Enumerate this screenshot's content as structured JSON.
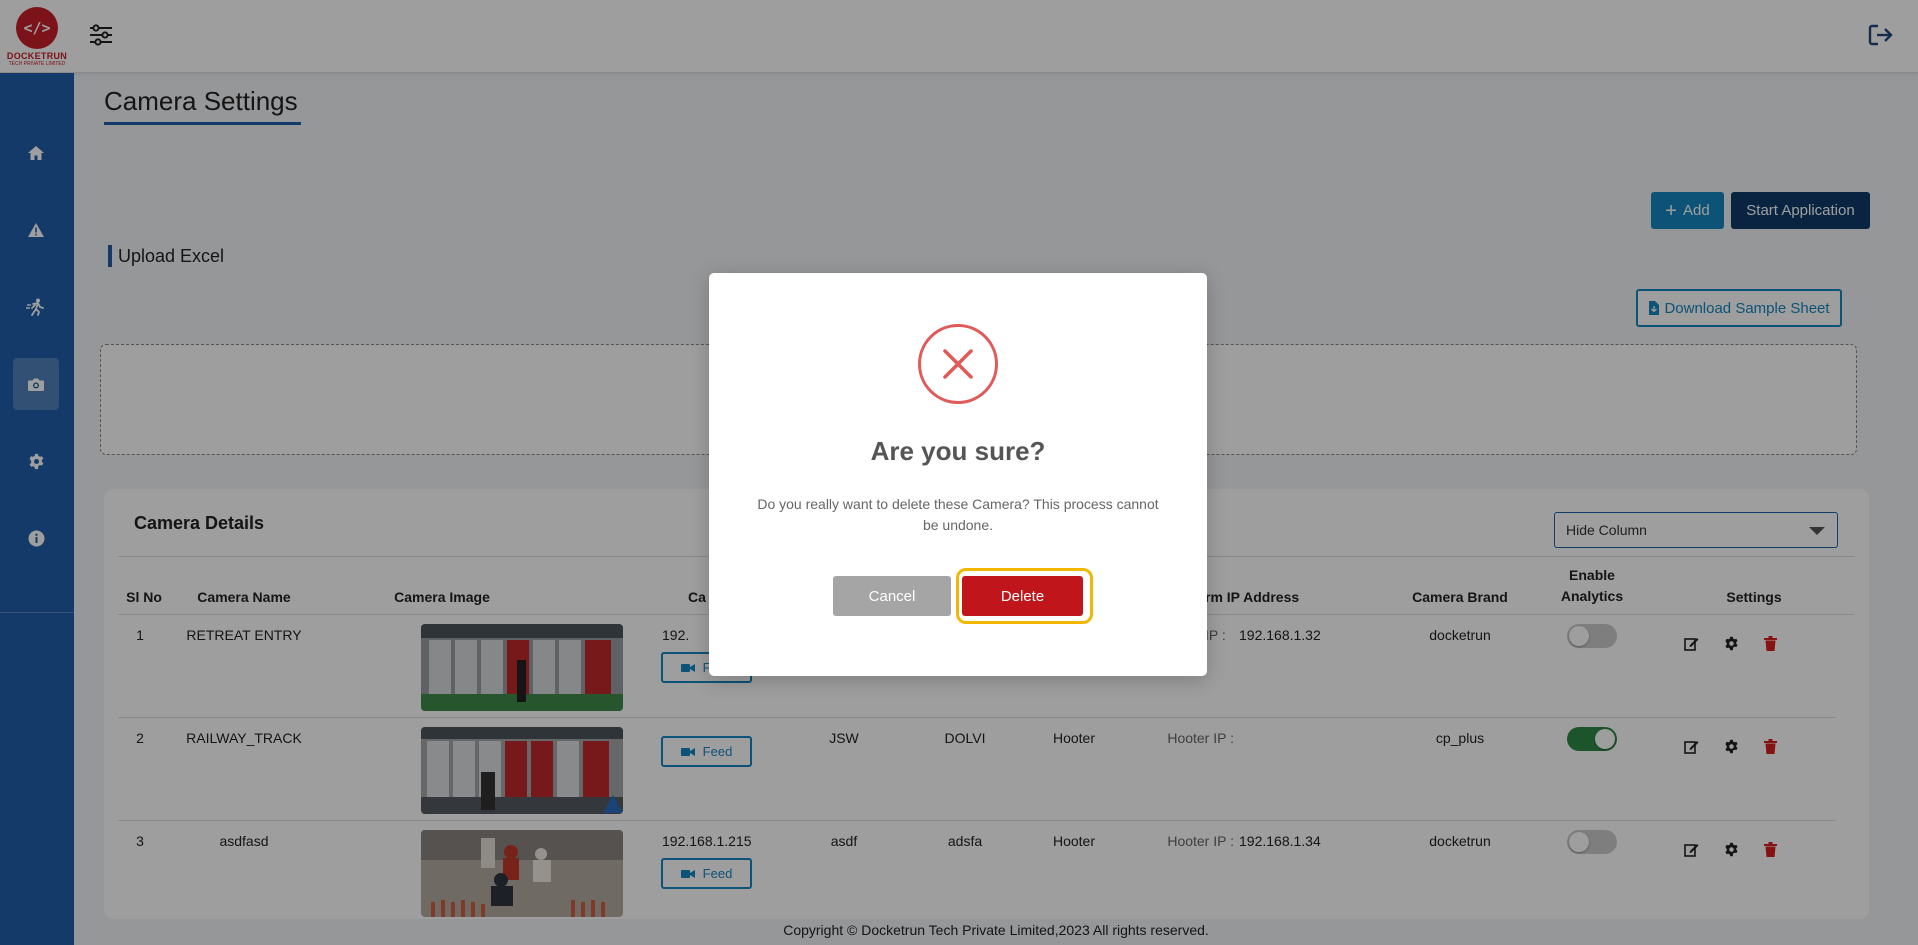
{
  "brand": {
    "logo_symbol": "</>",
    "name": "DOCKETRUN",
    "sub": "TECH PRIVATE LIMITED",
    "color": "#c8202a"
  },
  "topbar": {
    "filter_icon": "sliders-icon",
    "logout_icon": "logout-icon"
  },
  "sidebar": {
    "items": [
      {
        "icon": "home-icon"
      },
      {
        "icon": "warning-icon"
      },
      {
        "icon": "running-person-icon"
      },
      {
        "icon": "camera-icon",
        "active": true
      },
      {
        "icon": "gear-icon"
      },
      {
        "icon": "info-icon"
      }
    ]
  },
  "page": {
    "title": "Camera Settings",
    "add_label": "Add",
    "start_label": "Start Application",
    "upload_label": "Upload Excel",
    "download_label": "Download Sample Sheet"
  },
  "details": {
    "title": "Camera Details",
    "hide_column_label": "Hide Column",
    "headers": {
      "sl_no": "Sl No",
      "camera_name": "Camera Name",
      "camera_image": "Camera Image",
      "camera_ip_partial": "Ca",
      "alarm_ip_partial": "rm IP Address",
      "camera_brand": "Camera Brand",
      "enable_line1": "Enable",
      "enable_line2": "Analytics",
      "settings": "Settings"
    },
    "feed_label": "Feed",
    "rows": [
      {
        "sl": "1",
        "name": "RETREAT ENTRY",
        "ip": "192.",
        "company": "",
        "plant": "",
        "alarm": "",
        "hooter_label": "IP :",
        "hooter_ip": "192.168.1.32",
        "brand": "docketrun",
        "analytics": false
      },
      {
        "sl": "2",
        "name": "RAILWAY_TRACK",
        "ip": "",
        "company": "JSW",
        "plant": "DOLVI",
        "alarm": "Hooter",
        "hooter_label": "Hooter IP :",
        "hooter_ip": "",
        "brand": "cp_plus",
        "analytics": true
      },
      {
        "sl": "3",
        "name": "asdfasd",
        "ip": "192.168.1.215",
        "company": "asdf",
        "plant": "adsfa",
        "alarm": "Hooter",
        "hooter_label": "Hooter IP :",
        "hooter_ip": "192.168.1.34",
        "brand": "docketrun",
        "analytics": false
      }
    ]
  },
  "footer": "Copyright © Docketrun Tech Private Limited,2023 All rights reserved.",
  "modal": {
    "title": "Are you sure?",
    "message": "Do you really want to delete these Camera? This process cannot be undone.",
    "cancel_label": "Cancel",
    "delete_label": "Delete"
  }
}
